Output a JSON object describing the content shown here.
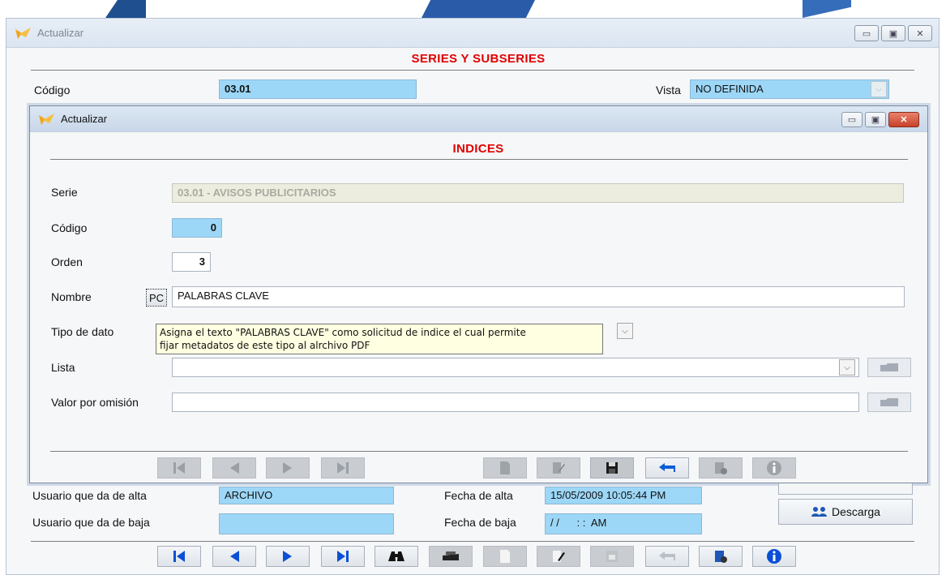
{
  "outer": {
    "title": "Actualizar",
    "heading": "SERIES Y SUBSERIES",
    "codigo_label": "Código",
    "codigo_value": "03.01",
    "vista_label": "Vista",
    "vista_value": "NO DEFINIDA",
    "usuario_alta_label": "Usuario que da de alta",
    "usuario_alta_value": "ARCHIVO",
    "usuario_baja_label": "Usuario que da de baja",
    "usuario_baja_value": "",
    "fecha_alta_label": "Fecha de alta",
    "fecha_alta_value": "15/05/2009 10:05:44 PM",
    "fecha_baja_label": "Fecha de baja",
    "fecha_baja_value": "/ /      : :  AM",
    "descarga_label": "Descarga"
  },
  "inner": {
    "title": "Actualizar",
    "heading": "INDICES",
    "serie_label": "Serie",
    "serie_value": "03.01 - AVISOS PUBLICITARIOS",
    "codigo_label": "Código",
    "codigo_value": "0",
    "orden_label": "Orden",
    "orden_value": "3",
    "nombre_label": "Nombre",
    "pc_button": "PC",
    "nombre_value": "PALABRAS CLAVE",
    "tipo_label": "Tipo de dato",
    "lista_label": "Lista",
    "lista_value": "",
    "valor_label": "Valor por omisión",
    "valor_value": ""
  },
  "tooltip": {
    "line1": "Asigna el texto \"PALABRAS CLAVE\" como solicitud de indice el cual permite",
    "line2": "fijar metadatos de este tipo al alrchivo PDF"
  },
  "colors": {
    "heading_red": "#e00000",
    "field_blue": "#9dd7f7",
    "nav_blue": "#0b4fd6"
  }
}
